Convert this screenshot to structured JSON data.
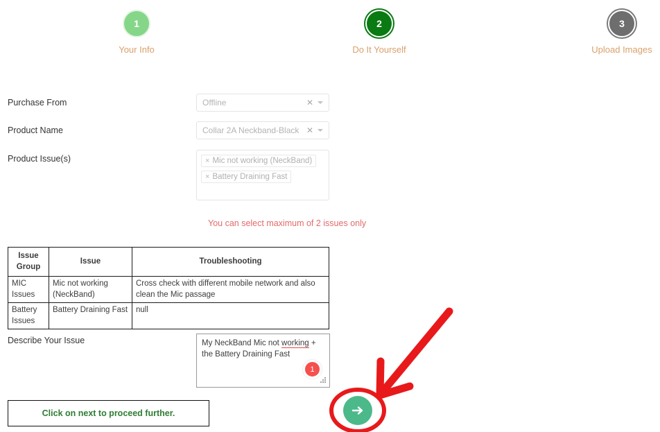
{
  "stepper": {
    "steps": [
      {
        "number": "1",
        "label": "Your Info",
        "state": "completed"
      },
      {
        "number": "2",
        "label": "Do It Yourself",
        "state": "active"
      },
      {
        "number": "3",
        "label": "Upload Images",
        "state": "pending"
      }
    ]
  },
  "form": {
    "purchase_from": {
      "label": "Purchase From",
      "value": "Offline",
      "clear_icon": "close-icon",
      "caret_icon": "chevron-down-icon"
    },
    "product_name": {
      "label": "Product Name",
      "value": "Collar 2A Neckband-Black",
      "clear_icon": "close-icon",
      "caret_icon": "chevron-down-icon"
    },
    "product_issues": {
      "label": "Product Issue(s)",
      "tags": [
        {
          "remove_icon": "close-icon",
          "label": "Mic not working (NeckBand)"
        },
        {
          "remove_icon": "close-icon",
          "label": "Battery Draining Fast"
        }
      ]
    },
    "warning": "You can select maximum of 2 issues only",
    "describe_issue": {
      "label": "Describe Your Issue",
      "value_before": "My NeckBand Mic not ",
      "value_misspelled": "working",
      "value_after": " + the Battery Draining Fast",
      "badge_count": "1"
    }
  },
  "table": {
    "headers": [
      "Issue Group",
      "Issue",
      "Troubleshooting"
    ],
    "rows": [
      {
        "group": "MIC Issues",
        "issue": "Mic not working (NeckBand)",
        "troubleshooting": "Cross check with different mobile network and also clean the Mic passage"
      },
      {
        "group": "Battery Issues",
        "issue": "Battery Draining Fast",
        "troubleshooting": "null"
      }
    ]
  },
  "footer": {
    "info_message": "Click on next to proceed further.",
    "next_button_icon": "arrow-right-icon"
  },
  "annotations": {
    "arrow_icon": "red-arrow-annotation",
    "ellipse_icon": "red-ellipse-annotation",
    "color": "#e8191b"
  },
  "colors": {
    "step_completed": "#86d68a",
    "step_active": "#0a7a12",
    "step_pending": "#6e6e6e",
    "step_label": "#d9a06b",
    "warning": "#e36a6a",
    "info_text": "#2e7d32",
    "next_button": "#4cb98b",
    "badge": "#f5504e",
    "annotation": "#e8191b"
  }
}
